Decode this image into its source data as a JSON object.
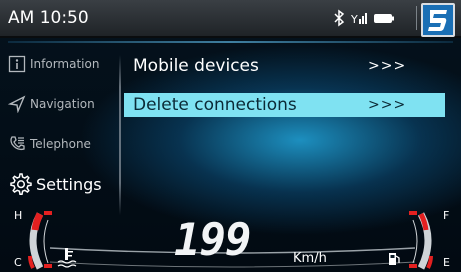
{
  "status_bar": {
    "time": "AM 10:50",
    "icons": [
      "bluetooth-icon",
      "signal-icon",
      "battery-icon"
    ],
    "brand_logo": "brand-logo-icon"
  },
  "sidebar": {
    "items": [
      {
        "label": "Information",
        "icon": "info-icon",
        "active": false
      },
      {
        "label": "Navigation",
        "icon": "navigation-arrow-icon",
        "active": false
      },
      {
        "label": "Telephone",
        "icon": "phone-icon",
        "active": false
      },
      {
        "label": "Settings",
        "icon": "gear-icon",
        "active": true
      }
    ]
  },
  "menu": {
    "items": [
      {
        "label": "Mobile devices",
        "arrows": ">>>",
        "selected": false
      },
      {
        "label": "Delete connections",
        "arrows": ">>>",
        "selected": true
      }
    ]
  },
  "cluster": {
    "speed": "199",
    "speed_unit": "Km/h",
    "temp_gauge": {
      "high_label": "H",
      "low_label": "C",
      "icon": "coolant-temp-icon"
    },
    "fuel_gauge": {
      "full_label": "F",
      "empty_label": "E",
      "icon": "fuel-pump-icon"
    }
  },
  "colors": {
    "selection": "#7fe2f2",
    "gauge_red": "#e32020",
    "brand_blue": "#1a6fb5"
  }
}
